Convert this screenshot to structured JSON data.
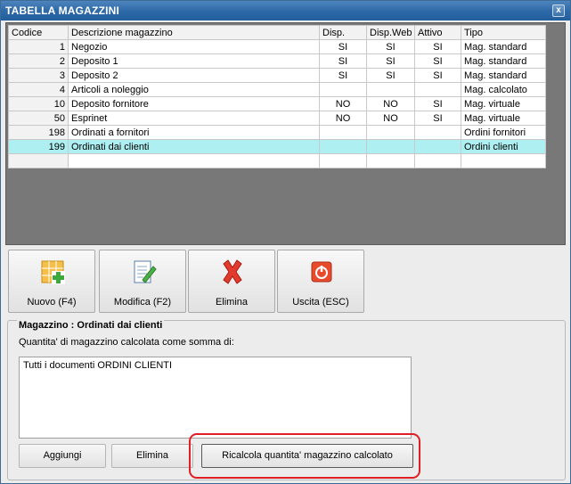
{
  "window": {
    "title": "TABELLA MAGAZZINI",
    "close_label": "x"
  },
  "table": {
    "headers": [
      "Codice",
      "Descrizione magazzino",
      "Disp.",
      "Disp.Web",
      "Attivo",
      "Tipo"
    ],
    "rows": [
      [
        "1",
        "Negozio",
        "SI",
        "SI",
        "SI",
        "Mag. standard"
      ],
      [
        "2",
        "Deposito 1",
        "SI",
        "SI",
        "SI",
        "Mag. standard"
      ],
      [
        "3",
        "Deposito 2",
        "SI",
        "SI",
        "SI",
        "Mag. standard"
      ],
      [
        "4",
        "Articoli a noleggio",
        "",
        "",
        "",
        "Mag. calcolato"
      ],
      [
        "10",
        "Deposito fornitore",
        "NO",
        "NO",
        "SI",
        "Mag. virtuale"
      ],
      [
        "50",
        "Esprinet",
        "NO",
        "NO",
        "SI",
        "Mag. virtuale"
      ],
      [
        "198",
        "Ordinati a fornitori",
        "",
        "",
        "",
        "Ordini fornitori"
      ],
      [
        "199",
        "Ordinati dai clienti",
        "",
        "",
        "",
        "Ordini clienti"
      ]
    ],
    "selected_index": 7,
    "selected_color": "#aef0f2"
  },
  "toolbar": {
    "new_label": "Nuovo (F4)",
    "edit_label": "Modifica (F2)",
    "delete_label": "Elimina",
    "exit_label": "Uscita (ESC)",
    "icons": [
      "grid-add-icon",
      "edit-document-icon",
      "delete-x-icon",
      "power-off-icon"
    ]
  },
  "detail": {
    "title": "Magazzino : Ordinati dai clienti",
    "subtitle": "Quantita' di magazzino calcolata come somma di:",
    "items": [
      "Tutti i documenti ORDINI CLIENTI"
    ],
    "add_label": "Aggiungi",
    "remove_label": "Elimina",
    "recalc_label": "Ricalcola quantita' magazzino calcolato"
  },
  "colors": {
    "title_bar": "#2f6aa8",
    "highlight_ring": "#e01e25"
  }
}
